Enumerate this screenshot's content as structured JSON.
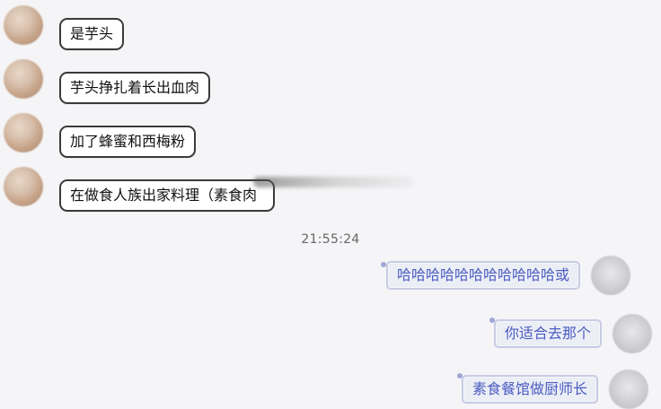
{
  "conversation": {
    "left_messages": [
      {
        "text": "是芋头"
      },
      {
        "text": "芋头挣扎着长出血肉"
      },
      {
        "text": "加了蜂蜜和西梅粉"
      },
      {
        "text": "在做食人族出家料理（素食肉"
      }
    ],
    "timestamp": "21:55:24",
    "right_messages": [
      {
        "text": "哈哈哈哈哈哈哈哈哈哈哈或"
      },
      {
        "text": "你适合去那个"
      },
      {
        "text": "素食餐馆做厨师长"
      }
    ]
  },
  "colors": {
    "background": "#f5f5f7",
    "left_bubble_bg": "#ffffff",
    "left_bubble_border": "#3a3a3a",
    "right_bubble_bg": "#eceef6",
    "right_bubble_border": "#c8cbe3",
    "right_text": "#4a5cc0",
    "timestamp_text": "#666666"
  }
}
